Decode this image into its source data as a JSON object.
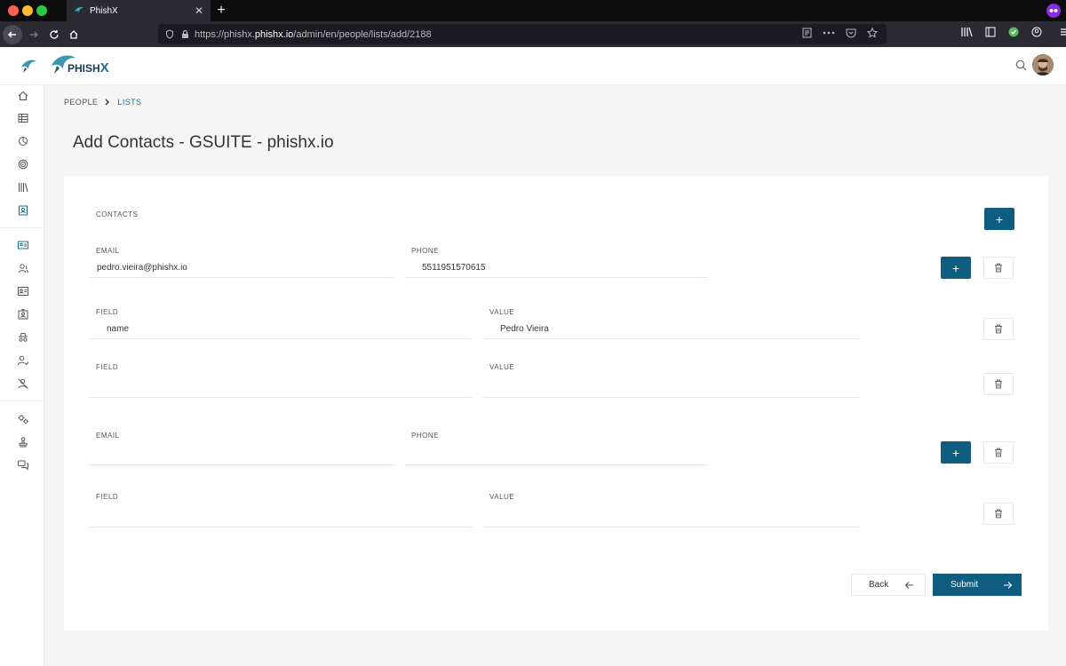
{
  "browser": {
    "tab_title": "PhishX",
    "url_scheme": "https://phishx.",
    "url_host": "phishx.io",
    "url_path": "/admin/en/people/lists/add/2188"
  },
  "app": {
    "logo_text_a": "PHISH",
    "logo_text_b": "X"
  },
  "breadcrumb": {
    "items": [
      "PEOPLE",
      "LISTS"
    ]
  },
  "page": {
    "title": "Add Contacts - GSUITE - phishx.io"
  },
  "form": {
    "section_label": "CONTACTS",
    "contacts": [
      {
        "email_label": "EMAIL",
        "email_value": "pedro.vieira@phishx.io",
        "phone_label": "PHONE",
        "phone_value": "5511951570615",
        "fields": [
          {
            "field_label": "FIELD",
            "field_value": "name",
            "value_label": "VALUE",
            "value_value": "Pedro Vieira"
          },
          {
            "field_label": "FIELD",
            "field_value": "",
            "value_label": "VALUE",
            "value_value": ""
          }
        ]
      },
      {
        "email_label": "EMAIL",
        "email_value": "",
        "phone_label": "PHONE",
        "phone_value": "",
        "fields": [
          {
            "field_label": "FIELD",
            "field_value": "",
            "value_label": "VALUE",
            "value_value": ""
          }
        ]
      }
    ],
    "plus_glyph": "+",
    "back_label": "Back",
    "submit_label": "Submit"
  },
  "colors": {
    "primary": "#0e5d80",
    "link": "#1f6f8b"
  }
}
